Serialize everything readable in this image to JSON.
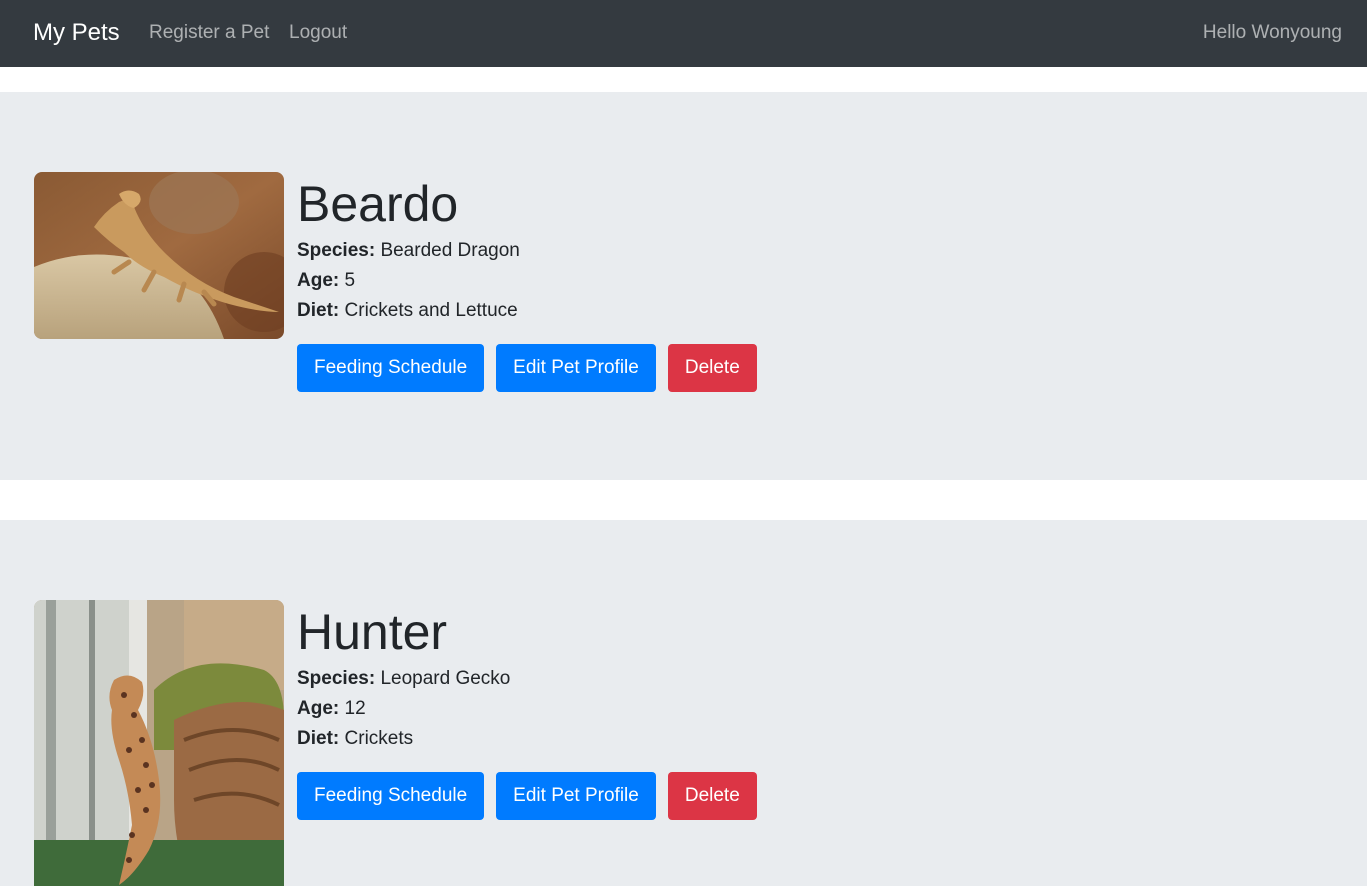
{
  "navbar": {
    "brand": "My Pets",
    "links": [
      "Register a Pet",
      "Logout"
    ],
    "greeting": "Hello Wonyoung",
    "background": "#343a40"
  },
  "pets": [
    {
      "name": "Beardo",
      "species_label": "Species:",
      "species": "Bearded Dragon",
      "age_label": "Age:",
      "age": "5",
      "diet_label": "Diet:",
      "diet": "Crickets and Lettuce",
      "photo_icon": "bearded-dragon-photo"
    },
    {
      "name": "Hunter",
      "species_label": "Species:",
      "species": "Leopard Gecko",
      "age_label": "Age:",
      "age": "12",
      "diet_label": "Diet:",
      "diet": "Crickets",
      "photo_icon": "leopard-gecko-photo"
    }
  ],
  "buttons": {
    "feeding": "Feeding Schedule",
    "edit": "Edit Pet Profile",
    "delete": "Delete"
  },
  "colors": {
    "primary": "#007bff",
    "danger": "#dc3545",
    "jumbotron": "#e9ecef"
  }
}
